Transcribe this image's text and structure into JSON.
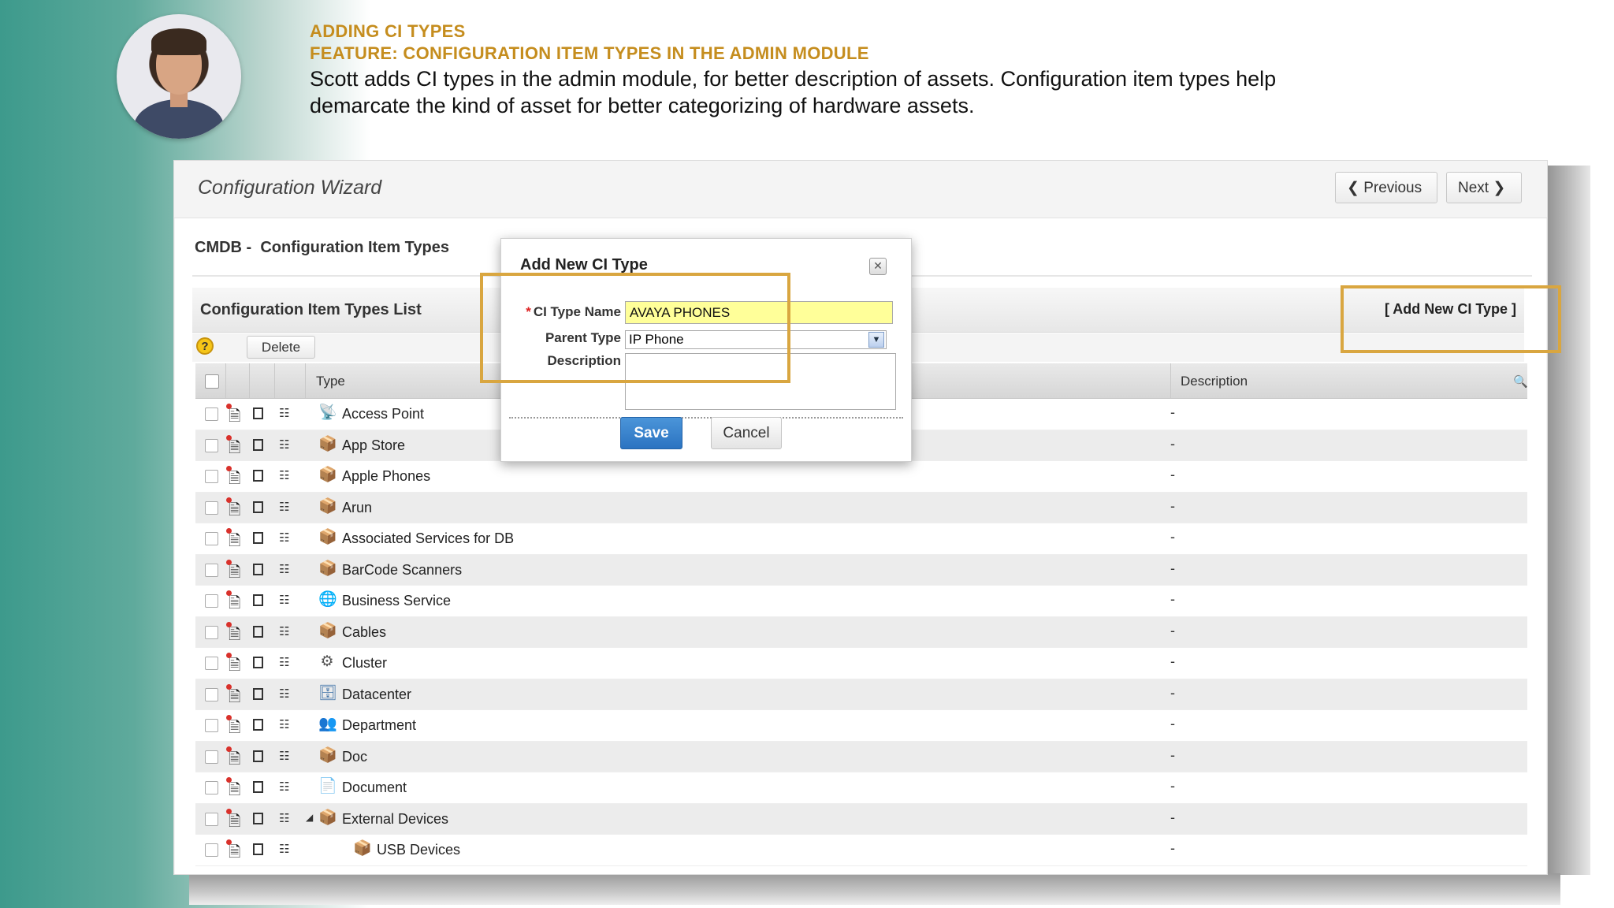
{
  "slide": {
    "heading": "ADDING CI TYPES",
    "feature": "FEATURE: CONFIGURATION ITEM TYPES IN THE ADMIN MODULE",
    "description": "Scott adds CI types in the admin module, for better description of assets. Configuration item types help demarcate the kind of asset for better categorizing of hardware assets.",
    "accent_color": "#c58d1e",
    "highlight_color": "#d9a640"
  },
  "wizard": {
    "title": "Configuration Wizard",
    "previous": "Previous",
    "next": "Next",
    "section_prefix": "CMDB -",
    "section_title": "Configuration Item Types"
  },
  "list": {
    "title": "Configuration Item Types List",
    "add_link": "[ Add New CI Type ]",
    "delete_label": "Delete",
    "help_icon": "?",
    "columns": {
      "type": "Type",
      "description": "Description"
    },
    "rows": [
      {
        "label": "Access Point",
        "icon": "access-point-icon",
        "desc": "-"
      },
      {
        "label": "App Store",
        "icon": "box-icon",
        "desc": "-"
      },
      {
        "label": "Apple Phones",
        "icon": "box-icon",
        "desc": "-"
      },
      {
        "label": "Arun",
        "icon": "box-icon",
        "desc": "-"
      },
      {
        "label": "Associated Services for DB",
        "icon": "box-icon",
        "desc": "-"
      },
      {
        "label": "BarCode Scanners",
        "icon": "box-icon",
        "desc": "-"
      },
      {
        "label": "Business Service",
        "icon": "business-service-icon",
        "desc": "-"
      },
      {
        "label": "Cables",
        "icon": "box-icon",
        "desc": "-"
      },
      {
        "label": "Cluster",
        "icon": "cluster-icon",
        "desc": "-"
      },
      {
        "label": "Datacenter",
        "icon": "datacenter-icon",
        "desc": "-"
      },
      {
        "label": "Department",
        "icon": "department-icon",
        "desc": "-"
      },
      {
        "label": "Doc",
        "icon": "box-icon",
        "desc": "-"
      },
      {
        "label": "Document",
        "icon": "document-icon",
        "desc": "-"
      },
      {
        "label": "External Devices",
        "icon": "box-icon",
        "desc": "-"
      },
      {
        "label": "USB Devices",
        "icon": "box-icon",
        "desc": "-"
      }
    ]
  },
  "modal": {
    "title": "Add New CI Type",
    "required_mark": "*",
    "ci_type_name_label": "CI Type Name",
    "ci_type_name_value": "AVAYA PHONES",
    "parent_type_label": "Parent Type",
    "parent_type_value": "IP Phone",
    "description_label": "Description",
    "save": "Save",
    "cancel": "Cancel"
  }
}
